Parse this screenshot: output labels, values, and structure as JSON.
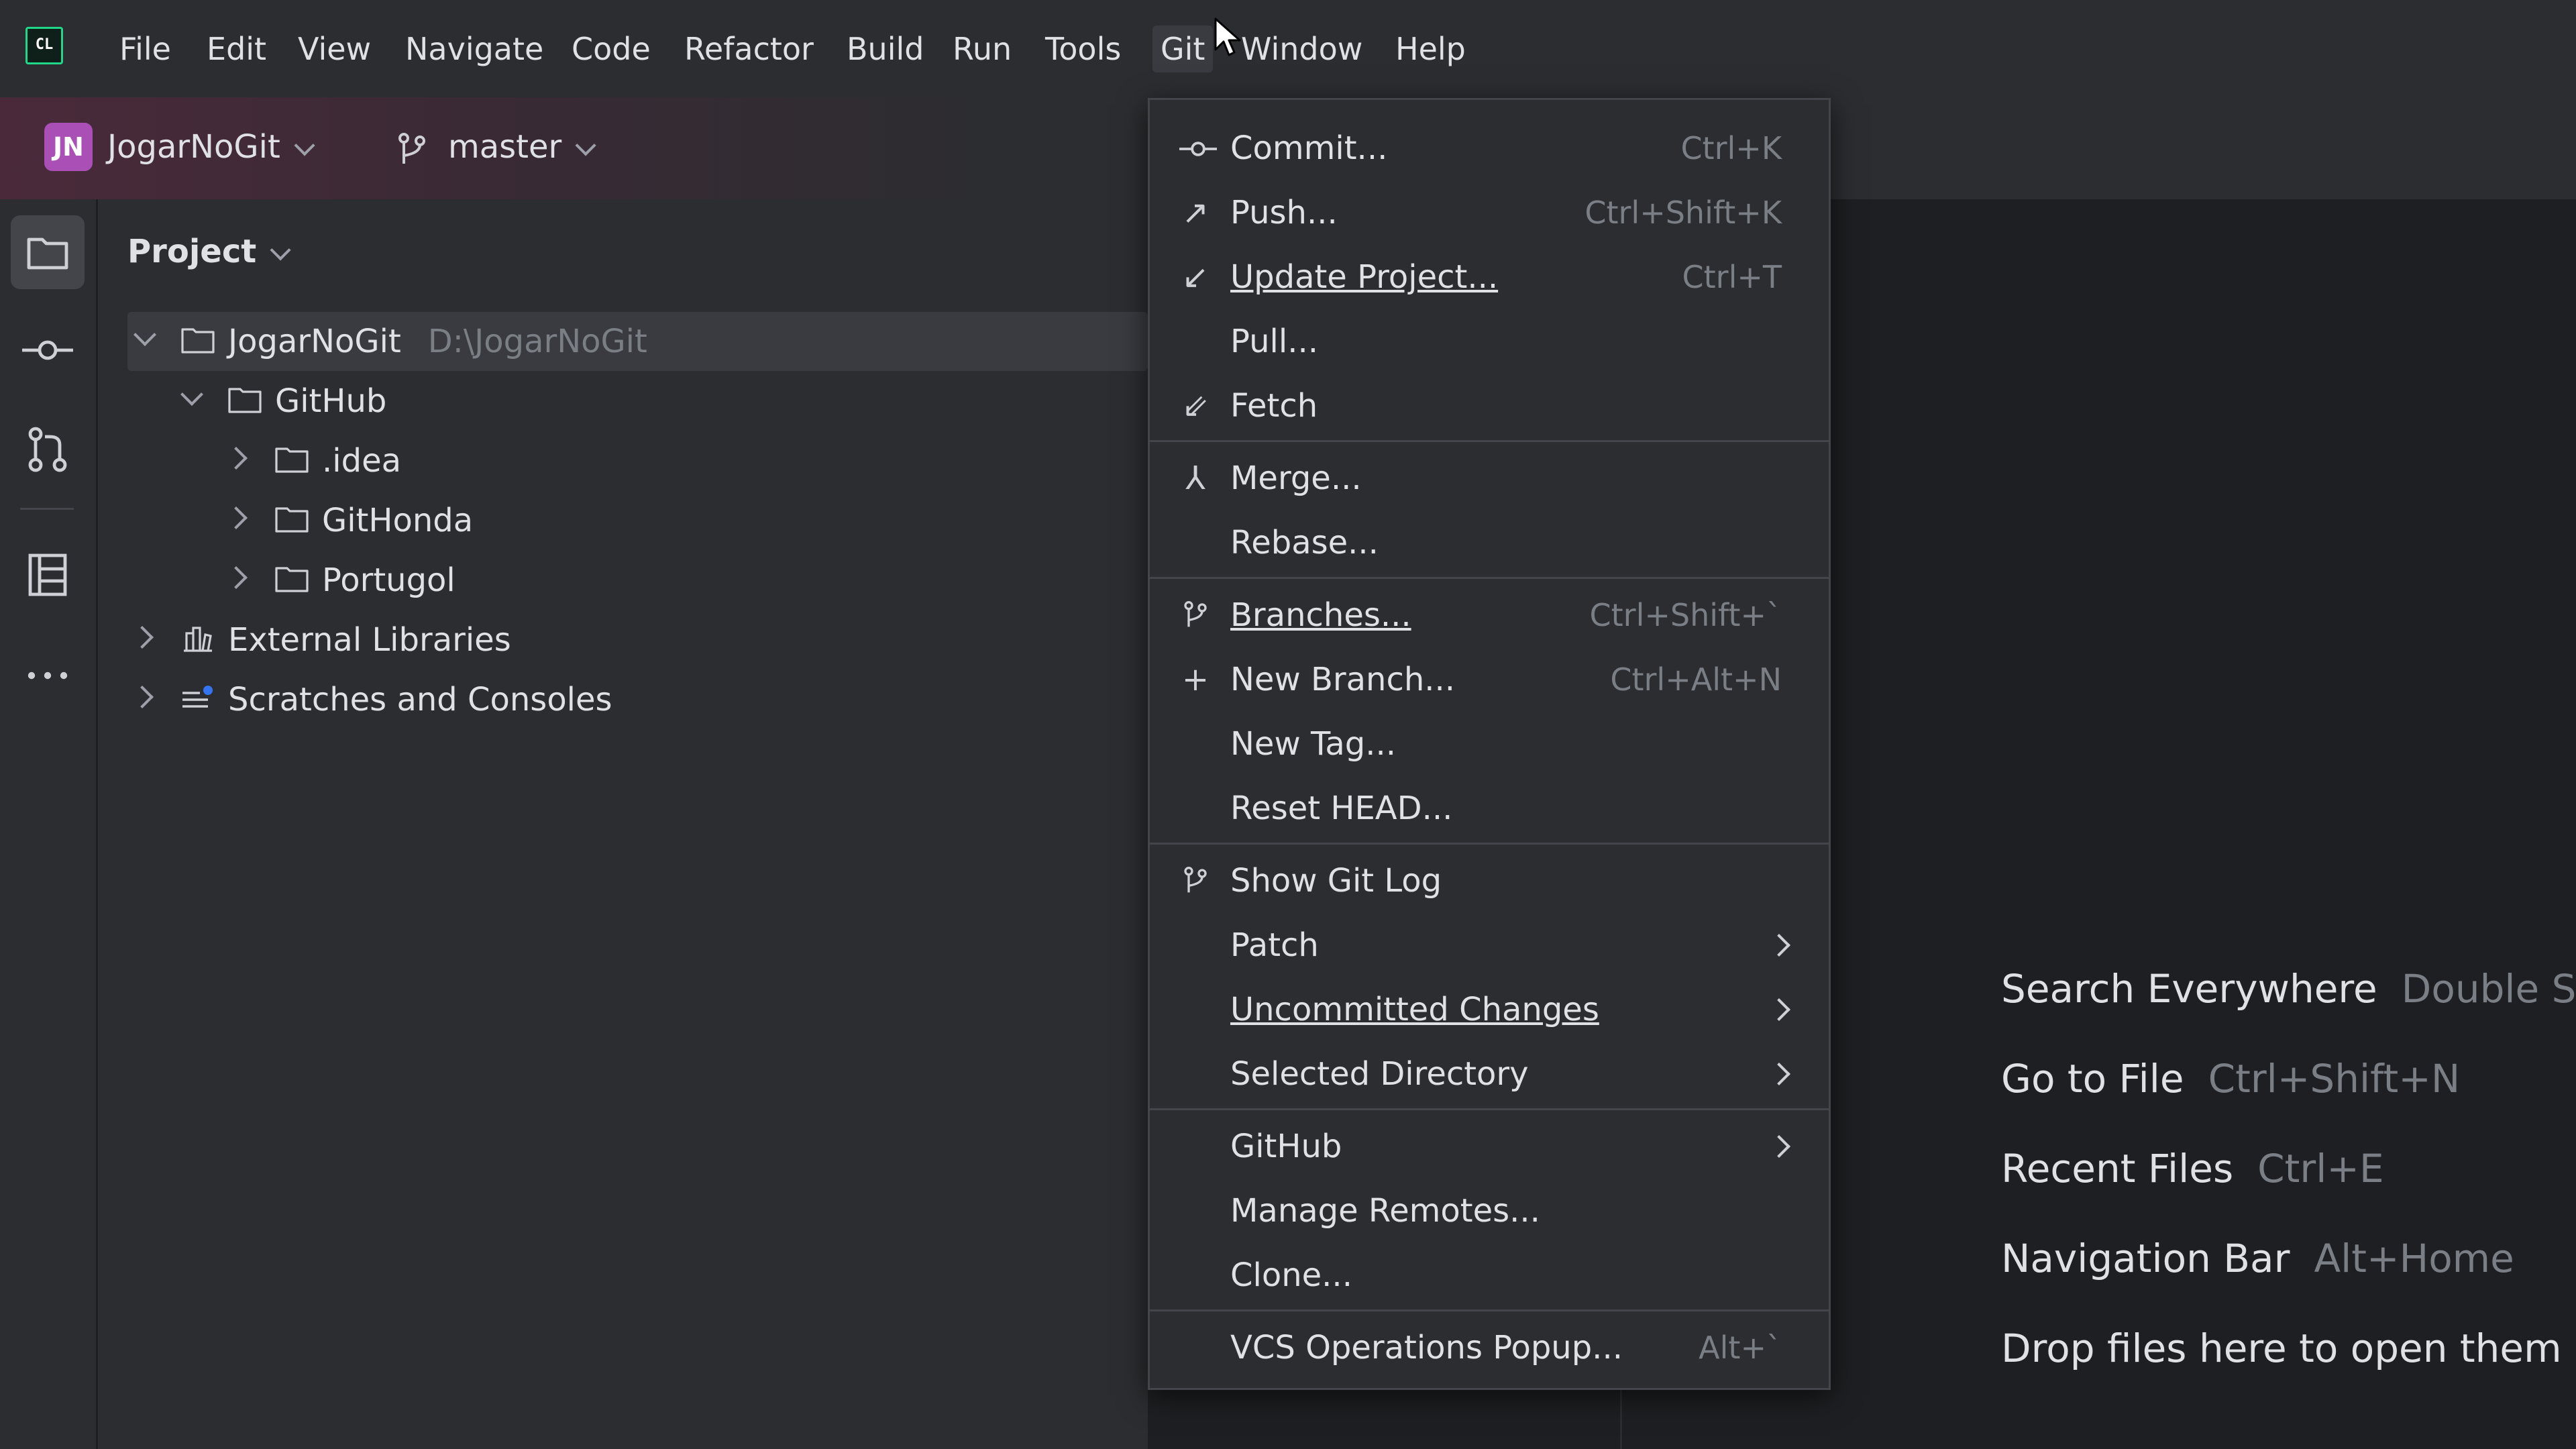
{
  "menubar": {
    "items": [
      "File",
      "Edit",
      "View",
      "Navigate",
      "Code",
      "Refactor",
      "Build",
      "Run",
      "Tools",
      "Git",
      "Window",
      "Help"
    ],
    "active": "Git",
    "logo": "CL"
  },
  "toolbar": {
    "project_badge": "JN",
    "project_name": "JogarNoGit",
    "branch": "master"
  },
  "project_panel": {
    "title": "Project",
    "tree": [
      {
        "label": "JogarNoGit",
        "path": "D:\\JogarNoGit"
      },
      {
        "label": "GitHub"
      },
      {
        "label": ".idea"
      },
      {
        "label": "GitHonda"
      },
      {
        "label": "Portugol"
      },
      {
        "label": "External Libraries"
      },
      {
        "label": "Scratches and Consoles"
      }
    ]
  },
  "git_menu": {
    "items": [
      {
        "label": "Commit...",
        "shortcut": "Ctrl+K",
        "icon": "commit-icon"
      },
      {
        "label": "Push...",
        "shortcut": "Ctrl+Shift+K",
        "icon": "push-icon"
      },
      {
        "label": "Update Project...",
        "shortcut": "Ctrl+T",
        "icon": "update-icon"
      },
      {
        "label": "Pull...",
        "shortcut": ""
      },
      {
        "label": "Fetch",
        "shortcut": "",
        "icon": "fetch-icon"
      },
      {
        "label": "Merge...",
        "shortcut": "",
        "icon": "merge-icon"
      },
      {
        "label": "Rebase...",
        "shortcut": ""
      },
      {
        "label": "Branches...",
        "shortcut": "Ctrl+Shift+`",
        "icon": "branch-icon"
      },
      {
        "label": "New Branch...",
        "shortcut": "Ctrl+Alt+N",
        "icon": "plus-icon"
      },
      {
        "label": "New Tag...",
        "shortcut": ""
      },
      {
        "label": "Reset HEAD...",
        "shortcut": ""
      },
      {
        "label": "Show Git Log",
        "shortcut": "",
        "icon": "git-log-icon"
      },
      {
        "label": "Patch",
        "submenu": true
      },
      {
        "label": "Uncommitted Changes",
        "submenu": true
      },
      {
        "label": "Selected Directory",
        "submenu": true
      },
      {
        "label": "GitHub",
        "submenu": true
      },
      {
        "label": "Manage Remotes...",
        "shortcut": ""
      },
      {
        "label": "Clone...",
        "shortcut": ""
      },
      {
        "label": "VCS Operations Popup...",
        "shortcut": "Alt+`"
      }
    ]
  },
  "editor_hints": [
    {
      "label": "Search Everywhere",
      "shortcut": "Double Sh"
    },
    {
      "label": "Go to File",
      "shortcut": "Ctrl+Shift+N"
    },
    {
      "label": "Recent Files",
      "shortcut": "Ctrl+E"
    },
    {
      "label": "Navigation Bar",
      "shortcut": "Alt+Home"
    },
    {
      "label": "Drop files here to open them",
      "shortcut": ""
    }
  ],
  "colors": {
    "background": "#1e1f22",
    "panel": "#2b2d30",
    "project_badge": "#a94fb5",
    "selection": "#393b40"
  }
}
